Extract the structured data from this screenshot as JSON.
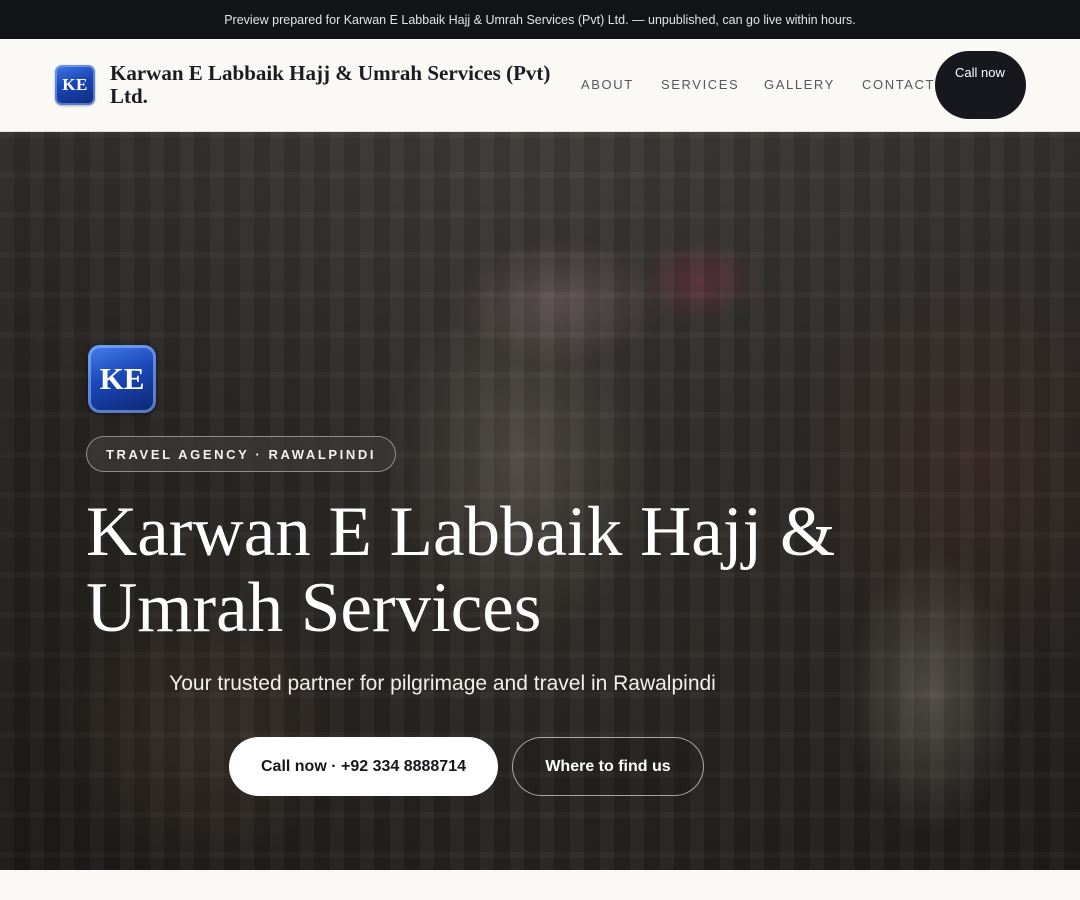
{
  "banner": {
    "text": "Preview prepared for Karwan E Labbaik Hajj & Umrah Services (Pvt) Ltd. — unpublished, can go live within hours."
  },
  "nav": {
    "logo_text": "KE",
    "brand": "Karwan E Labbaik Hajj & Umrah Services (Pvt) Ltd.",
    "links": [
      "About",
      "Services",
      "Gallery",
      "Contact"
    ],
    "call_label": "Call now"
  },
  "hero": {
    "logo_text": "KE",
    "badge": "TRAVEL AGENCY · RAWALPINDI",
    "title": "Karwan E Labbaik Hajj & Umrah Services",
    "subtitle": "Your trusted partner for pilgrimage and travel in Rawalpindi",
    "primary_button": "Call now · +92 334 8888714",
    "secondary_button": "Where to find us",
    "background_image": "dim photo of a crowded shop interior with hanging goods and shelves"
  },
  "colors": {
    "banner_bg": "#121418",
    "nav_bg": "#faf9f6",
    "dark_button": "#16181d",
    "logo_blue": "#1b46b6"
  }
}
